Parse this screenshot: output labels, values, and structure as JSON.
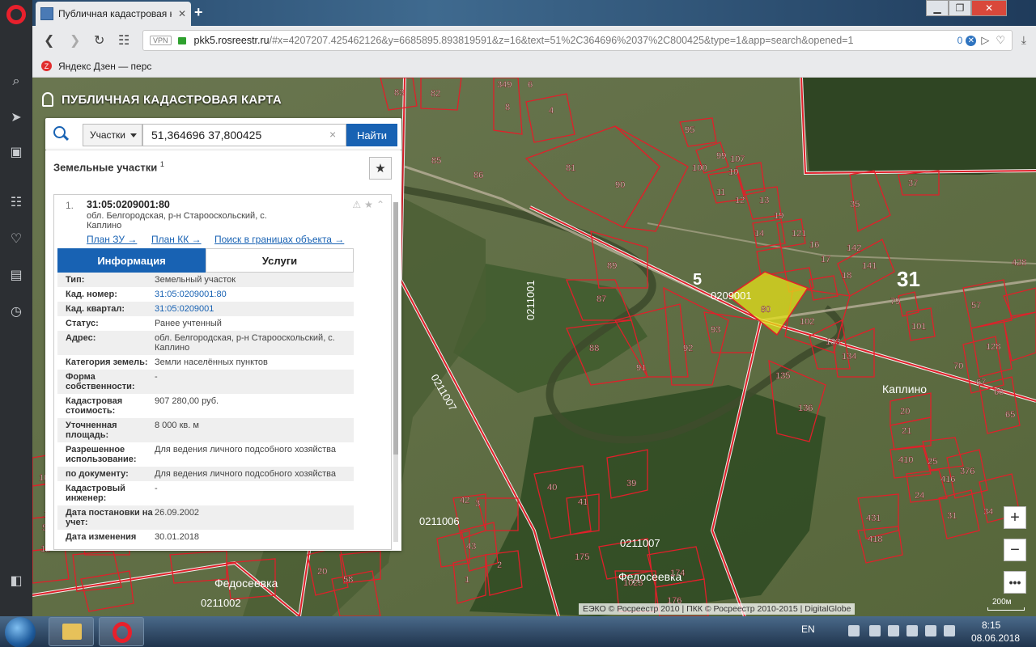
{
  "browser": {
    "tab_title": "Публичная кадастровая к",
    "new_tab": "+",
    "url_host": "pkk5.rosreestr.ru",
    "url_rest": "/#x=4207207.425462126&y=6685895.893819591&z=16&text=51%2C364696%2037%2C800425&type=1&app=search&opened=1",
    "vpn_label": "VPN",
    "url_count": "0",
    "bookmark_label": "Яндекс Дзен — перс",
    "bookmark_badge": "Z"
  },
  "map": {
    "brand": "ПУБЛИЧНАЯ КАДАСТРОВАЯ КАРТА",
    "big_region_label": "31",
    "big_region_left": "3",
    "quarter_center": "5",
    "quarter_id": "0209001",
    "selected_parcel": "80",
    "quarters": [
      "0211001",
      "0211007",
      "0211006",
      "0211007",
      "0211002",
      "0209001"
    ],
    "places": [
      "Каплино",
      "Федосеевка",
      "Федосеевка"
    ],
    "parcels": [
      "83",
      "82",
      "349",
      "6",
      "8",
      "4",
      "95",
      "85",
      "86",
      "81",
      "90",
      "100",
      "99",
      "10",
      "107",
      "11",
      "12",
      "13",
      "19",
      "14",
      "121",
      "16",
      "17",
      "142",
      "141",
      "18",
      "35",
      "37",
      "89",
      "87",
      "88",
      "91",
      "92",
      "93",
      "102",
      "133",
      "134",
      "135",
      "136",
      "79",
      "101",
      "57",
      "128",
      "70",
      "67",
      "66",
      "65",
      "20",
      "21",
      "410",
      "25",
      "376",
      "416",
      "24",
      "431",
      "418",
      "31",
      "34",
      "428",
      "39",
      "40",
      "41",
      "42",
      "43",
      "1",
      "2",
      "3",
      "175",
      "174",
      "176",
      "1023",
      "1016",
      "112",
      "19",
      "20",
      "58",
      "56",
      "57",
      "12"
    ],
    "attribution": "ЕЭКО © Росреестр 2010 | ПКК © Росреестр 2010-2015 | DigitalGlobe",
    "scale": "200м",
    "zoom_in": "+",
    "zoom_out": "−",
    "more": "•••"
  },
  "search": {
    "type_label": "Участки",
    "query": "51,364696 37,800425",
    "clear": "×",
    "button_label": "Найти"
  },
  "results": {
    "header": "Земельные участки",
    "count": "1",
    "fav_icon": "★",
    "item": {
      "index": "1.",
      "cadnum": "31:05:0209001:80",
      "address": "обл. Белгородская, р-н Старооскольский, с. Каплино",
      "links": [
        "План ЗУ →",
        "План КК →",
        "Поиск в границах объекта →"
      ],
      "tabs": [
        "Информация",
        "Услуги"
      ],
      "rows": [
        {
          "key": "Тип:",
          "val": "Земельный участок"
        },
        {
          "key": "Кад. номер:",
          "val": "31:05:0209001:80"
        },
        {
          "key": "Кад. квартал:",
          "val": "31:05:0209001"
        },
        {
          "key": "Статус:",
          "val": "Ранее учтенный"
        },
        {
          "key": "Адрес:",
          "val": "обл. Белгородская, р-н Старооскольский, с. Каплино"
        },
        {
          "key": "Категория земель:",
          "val": "Земли населённых пунктов"
        },
        {
          "key": "Форма собственности:",
          "val": "-"
        },
        {
          "key": "Кадастровая стоимость:",
          "val": "907 280,00 руб."
        },
        {
          "key": "Уточненная площадь:",
          "val": "8 000 кв. м"
        },
        {
          "key": "Разрешенное использование:",
          "val": "Для ведения личного подсобного хозяйства"
        },
        {
          "key": "по документу:",
          "val": "Для ведения личного подсобного хозяйства"
        },
        {
          "key": "Кадастровый инженер:",
          "val": "-"
        },
        {
          "key": "Дата постановки на учет:",
          "val": "26.09.2002"
        },
        {
          "key": "Дата изменения",
          "val": "30.01.2018"
        }
      ]
    }
  },
  "taskbar": {
    "lang": "EN",
    "time": "8:15",
    "date": "08.06.2018"
  },
  "colors": {
    "accent_blue": "#1862b3",
    "parcel_red": "#e0202a",
    "selected_fill": "#e6e21a"
  }
}
